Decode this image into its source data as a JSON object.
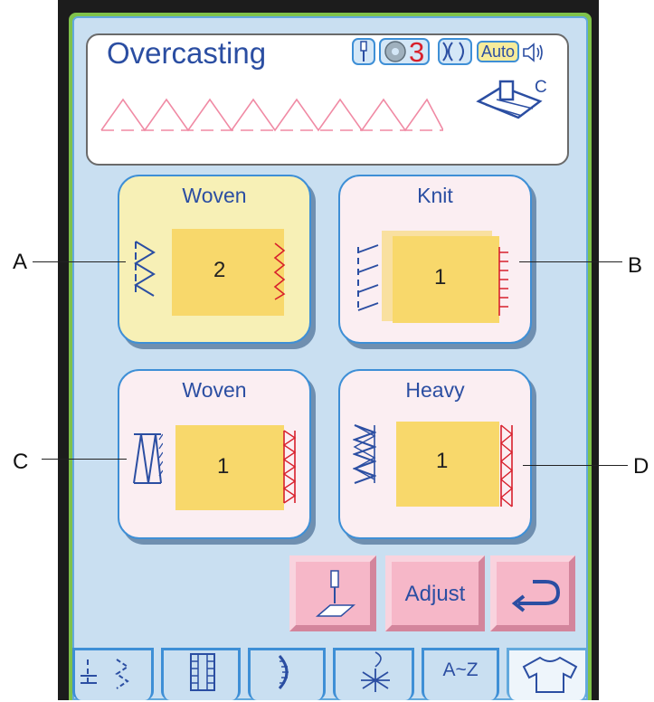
{
  "screen": {
    "title": "Overcasting",
    "needle_count": "3",
    "presser_foot_letter": "C",
    "auto_label": "Auto"
  },
  "cards": [
    {
      "fabric_label": "Woven",
      "stitch_number": "2",
      "selected": true,
      "callout": "A"
    },
    {
      "fabric_label": "Knit",
      "stitch_number": "1",
      "selected": false,
      "callout": "B"
    },
    {
      "fabric_label": "Woven",
      "stitch_number": "1",
      "selected": false,
      "callout": "C"
    },
    {
      "fabric_label": "Heavy",
      "stitch_number": "1",
      "selected": false,
      "callout": "D"
    }
  ],
  "buttons": {
    "adjust_label": "Adjust"
  },
  "tabs": {
    "alphabet_label": "A~Z"
  },
  "icons": [
    "needle-icon",
    "bobbin-icon",
    "tension-icon",
    "speaker-icon",
    "presser-foot-icon",
    "needle-position-icon",
    "return-icon",
    "straight-stitch-icon",
    "buttonhole-icon",
    "decorative-stitch-icon",
    "quilt-stitch-icon",
    "alphabet-icon",
    "garment-icon"
  ],
  "colors": {
    "accent_blue": "#3e8fd6",
    "screen_background": "#c9dff1",
    "selected_card": "#f7f0b6",
    "unselected_card": "#fbeef2",
    "fabric": "#f8d86b",
    "stitch_red": "#d8202c",
    "button_pink": "#f6b7c8"
  }
}
